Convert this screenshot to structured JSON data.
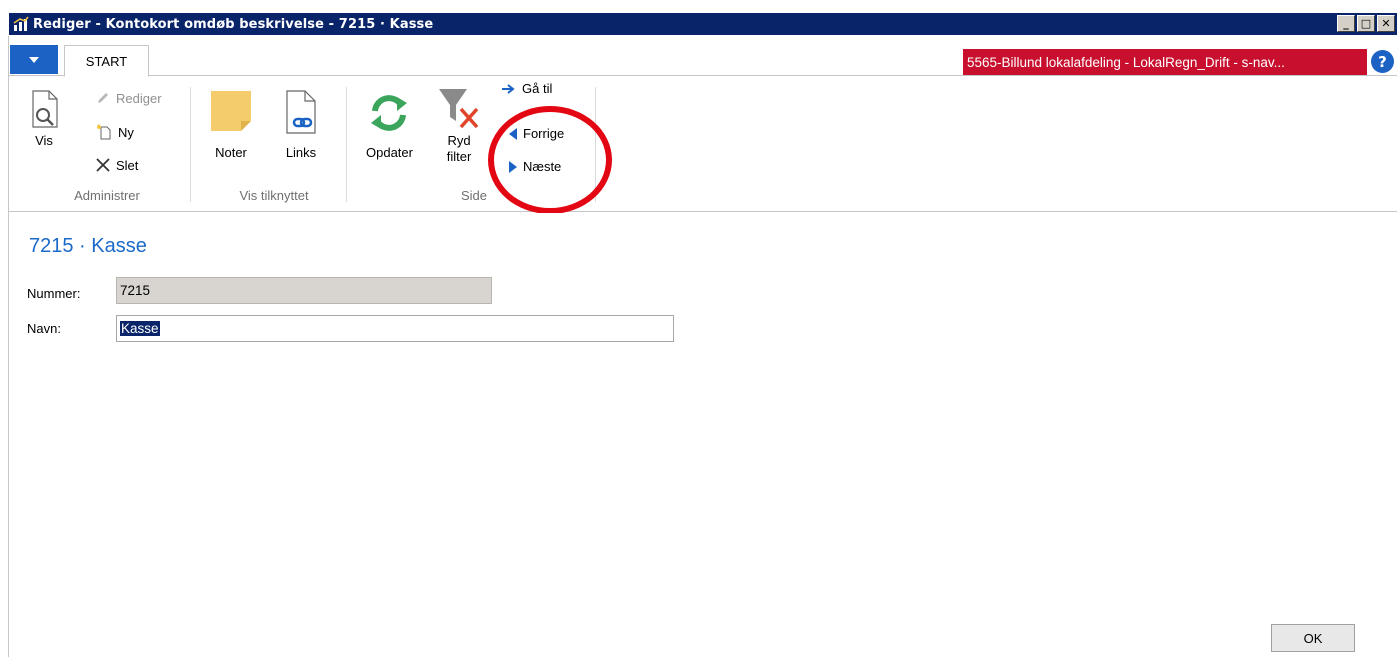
{
  "window": {
    "title": "Rediger - Kontokort omdøb beskrivelse - 7215 · Kasse",
    "controls": [
      "_",
      "□",
      "✕"
    ]
  },
  "tabs": {
    "start": "START"
  },
  "company": "5565-Billund lokalafdeling - LokalRegn_Drift - s-nav...",
  "help": "?",
  "ribbon": {
    "groups": {
      "administrer": "Administrer",
      "vis_tilknyttet": "Vis tilknyttet",
      "side": "Side"
    },
    "buttons": {
      "vis": "Vis",
      "rediger": "Rediger",
      "ny": "Ny",
      "slet": "Slet",
      "noter": "Noter",
      "links": "Links",
      "opdater": "Opdater",
      "ryd_filter_1": "Ryd",
      "ryd_filter_2": "filter",
      "ga_til": "Gå til",
      "forrige": "Forrige",
      "naeste": "Næste"
    }
  },
  "page": {
    "title": "7215 · Kasse",
    "fields": {
      "nummer_label": "Nummer:",
      "nummer_value": "7215",
      "navn_label": "Navn:",
      "navn_value": "Kasse"
    },
    "ok": "OK"
  },
  "colors": {
    "titlebar": "#0a246a",
    "accent_blue": "#1b62c4",
    "company_red": "#c8102e",
    "annotation_red": "#e30613"
  }
}
